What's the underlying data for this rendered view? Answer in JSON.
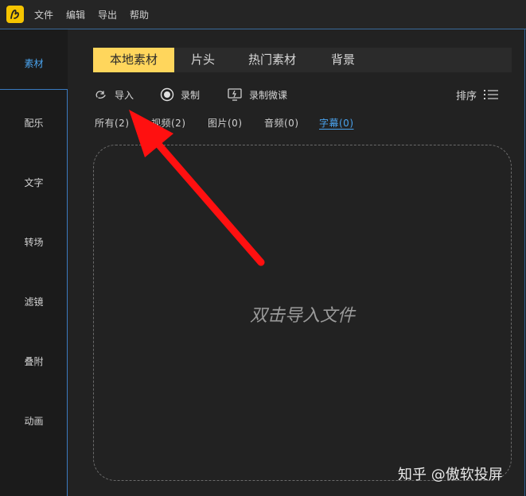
{
  "menu": [
    "文件",
    "编辑",
    "导出",
    "帮助"
  ],
  "sidebar": {
    "items": [
      {
        "label": "素材",
        "active": true
      },
      {
        "label": "配乐",
        "active": false
      },
      {
        "label": "文字",
        "active": false
      },
      {
        "label": "转场",
        "active": false
      },
      {
        "label": "滤镜",
        "active": false
      },
      {
        "label": "叠附",
        "active": false
      },
      {
        "label": "动画",
        "active": false
      }
    ]
  },
  "tabs": [
    {
      "label": "本地素材",
      "active": true
    },
    {
      "label": "片头",
      "active": false
    },
    {
      "label": "热门素材",
      "active": false
    },
    {
      "label": "背景",
      "active": false
    }
  ],
  "toolbar": {
    "import_label": "导入",
    "record_label": "录制",
    "record_course_label": "录制微课",
    "sort_label": "排序"
  },
  "filters": [
    {
      "label": "所有(2)",
      "active": false
    },
    {
      "label": "视频(2)",
      "active": false
    },
    {
      "label": "图片(0)",
      "active": false
    },
    {
      "label": "音频(0)",
      "active": false
    },
    {
      "label": "字幕(0)",
      "active": true
    }
  ],
  "dropzone": {
    "hint": "双击导入文件"
  },
  "watermark": "知乎 @傲软投屏",
  "colors": {
    "accent": "#ffd65c",
    "active_link": "#4aa3ee",
    "annotation_arrow": "#ff1010"
  }
}
